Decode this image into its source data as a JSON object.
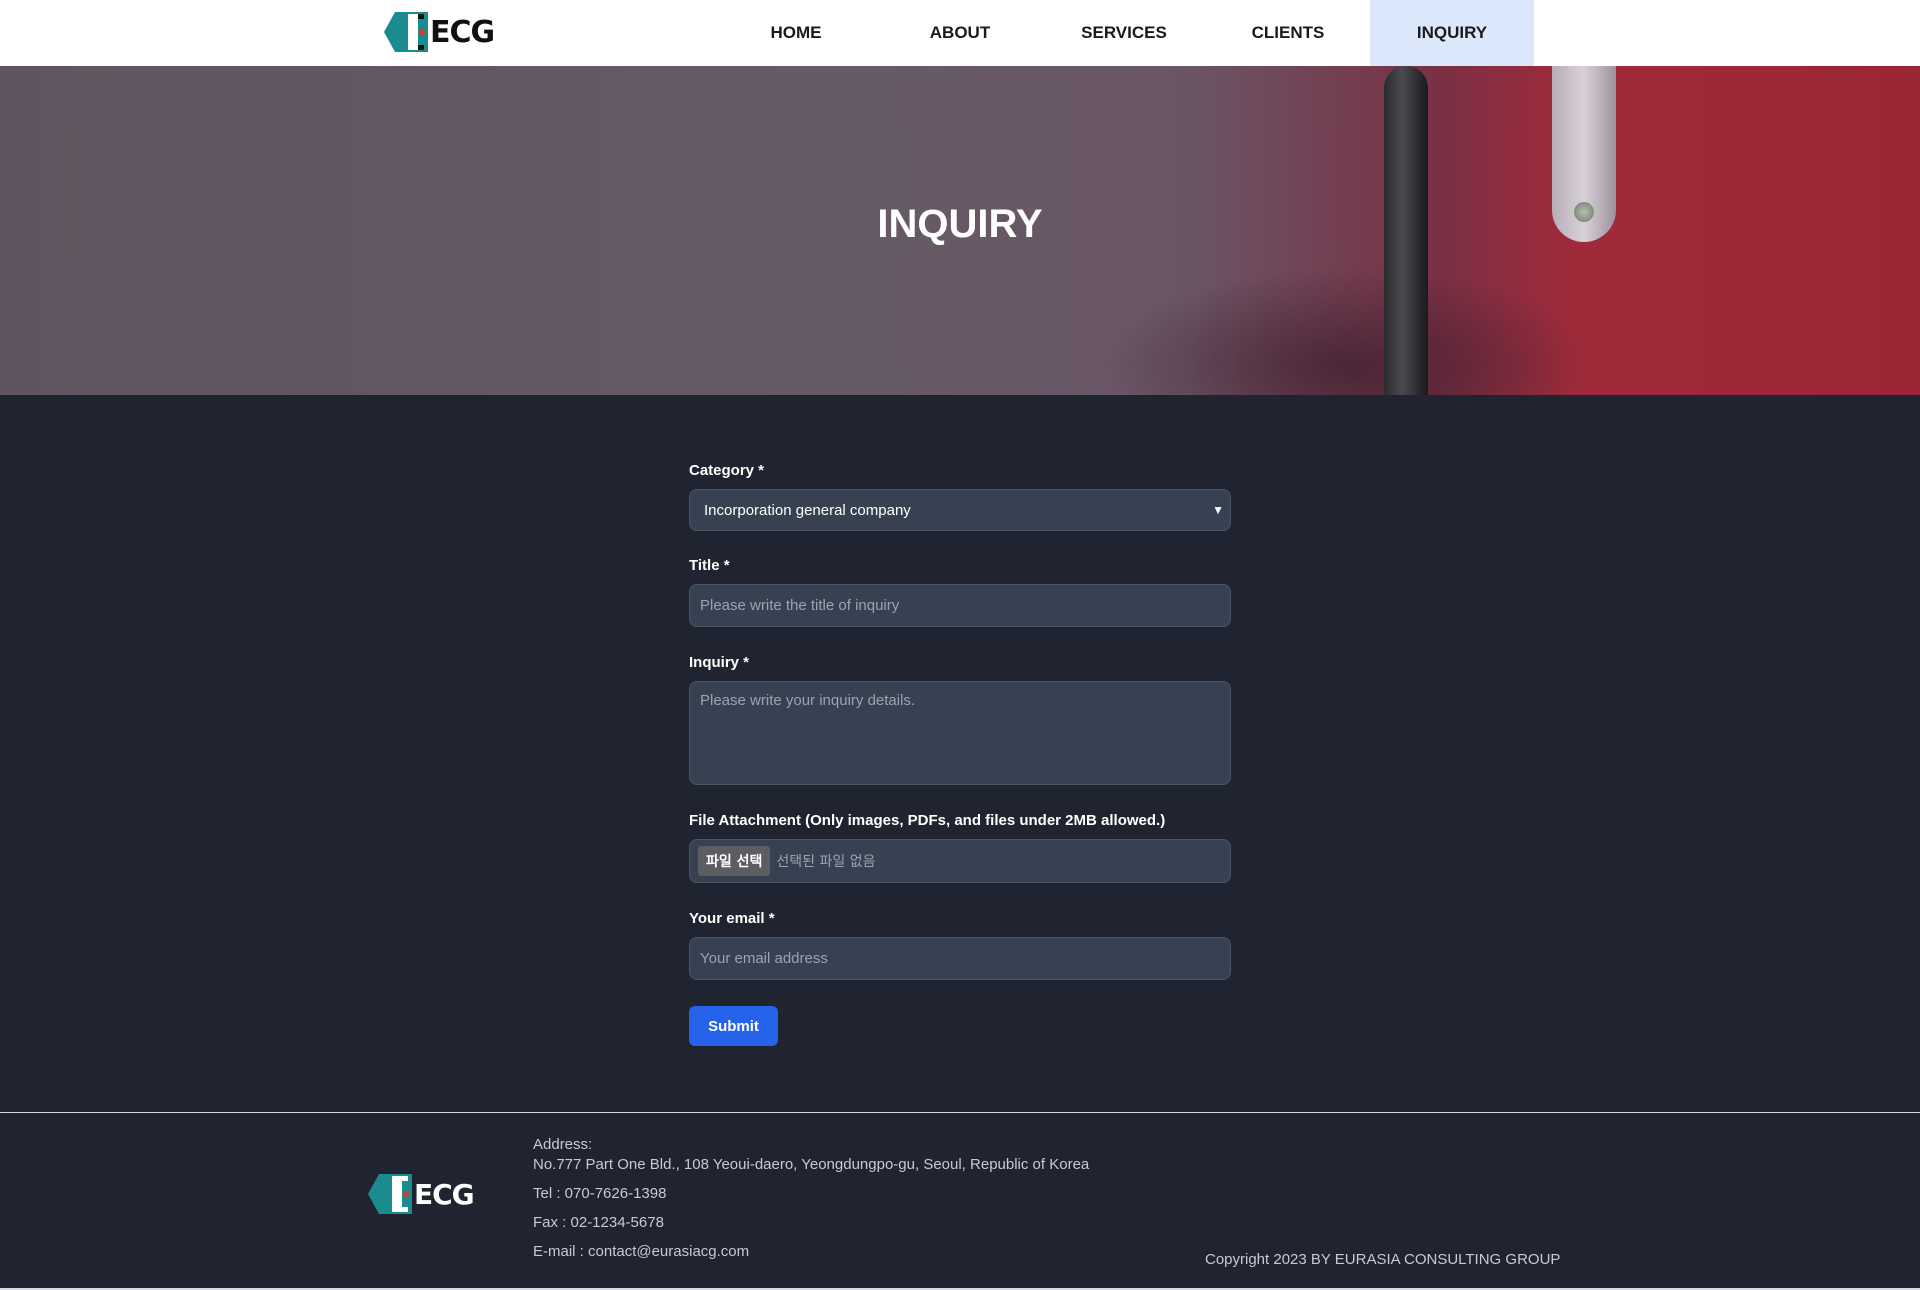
{
  "header": {
    "logo_text": "ECG",
    "nav": [
      {
        "label": "HOME",
        "active": false
      },
      {
        "label": "ABOUT",
        "active": false
      },
      {
        "label": "SERVICES",
        "active": false
      },
      {
        "label": "CLIENTS",
        "active": false
      },
      {
        "label": "INQUIRY",
        "active": true
      }
    ]
  },
  "hero": {
    "title": "INQUIRY"
  },
  "form": {
    "category_label": "Category *",
    "category_value": "Incorporation general company",
    "title_label": "Title *",
    "title_placeholder": "Please write the title of inquiry",
    "inquiry_label": "Inquiry *",
    "inquiry_placeholder": "Please write your inquiry details.",
    "file_label": "File Attachment (Only images, PDFs, and files under 2MB allowed.)",
    "file_button": "파일 선택",
    "file_status": "선택된 파일 없음",
    "email_label": "Your email *",
    "email_placeholder": "Your email address",
    "submit_label": "Submit"
  },
  "footer": {
    "logo_text": "ECG",
    "address_label": "Address:",
    "address": "No.777 Part One Bld., 108 Yeoui-daero, Yeongdungpo-gu, Seoul, Republic of Korea",
    "tel": "Tel : 070-7626-1398",
    "fax": "Fax : 02-1234-5678",
    "email": "E-mail : contact@eurasiacg.com",
    "copyright": "Copyright 2023 BY EURASIA CONSULTING GROUP"
  },
  "colors": {
    "primary_button": "#2563eb",
    "active_nav_bg": "#dbe8fb",
    "logo_teal": "#1a8c8f",
    "logo_red": "#e3342f",
    "page_bg": "#1f2430"
  }
}
